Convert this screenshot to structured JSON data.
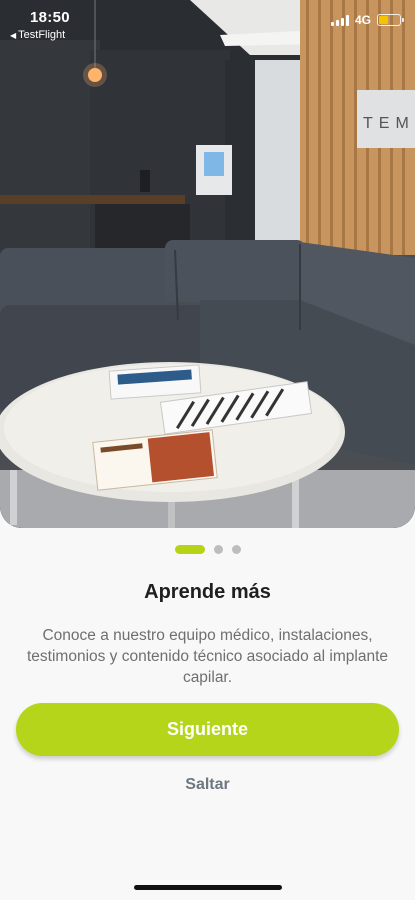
{
  "status_bar": {
    "time": "18:50",
    "back_app": "TestFlight",
    "network": "4G"
  },
  "hero": {
    "image": "clinic-lounge-photo",
    "wall_sign": "TEM"
  },
  "pager": {
    "total": 3,
    "active_index": 0
  },
  "slide": {
    "title": "Aprende más",
    "description": "Conoce a nuestro equipo médico, instalaciones, testimonios y contenido técnico asociado al implante capilar."
  },
  "actions": {
    "next_label": "Siguiente",
    "skip_label": "Saltar"
  },
  "colors": {
    "accent": "#b5d51a",
    "skip_text": "#6c7780",
    "title_text": "#1f1f1f",
    "body_text": "#6f6f6f"
  }
}
